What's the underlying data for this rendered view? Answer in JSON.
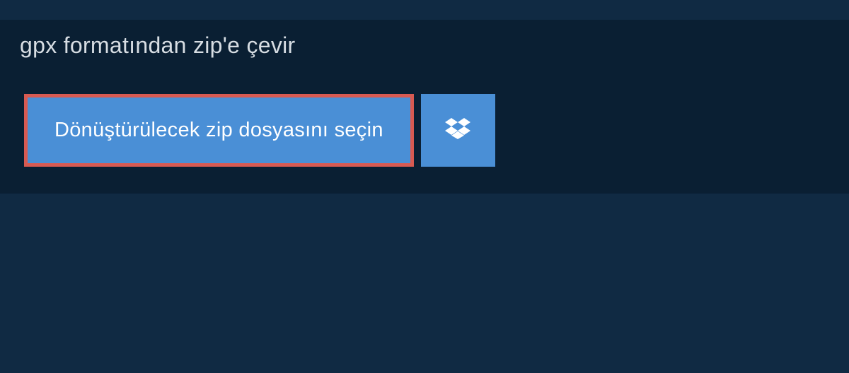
{
  "header": {
    "title": "gpx formatından zip'e çevir"
  },
  "actions": {
    "select_file_label": "Dönüştürülecek zip dosyasını seçin"
  }
}
